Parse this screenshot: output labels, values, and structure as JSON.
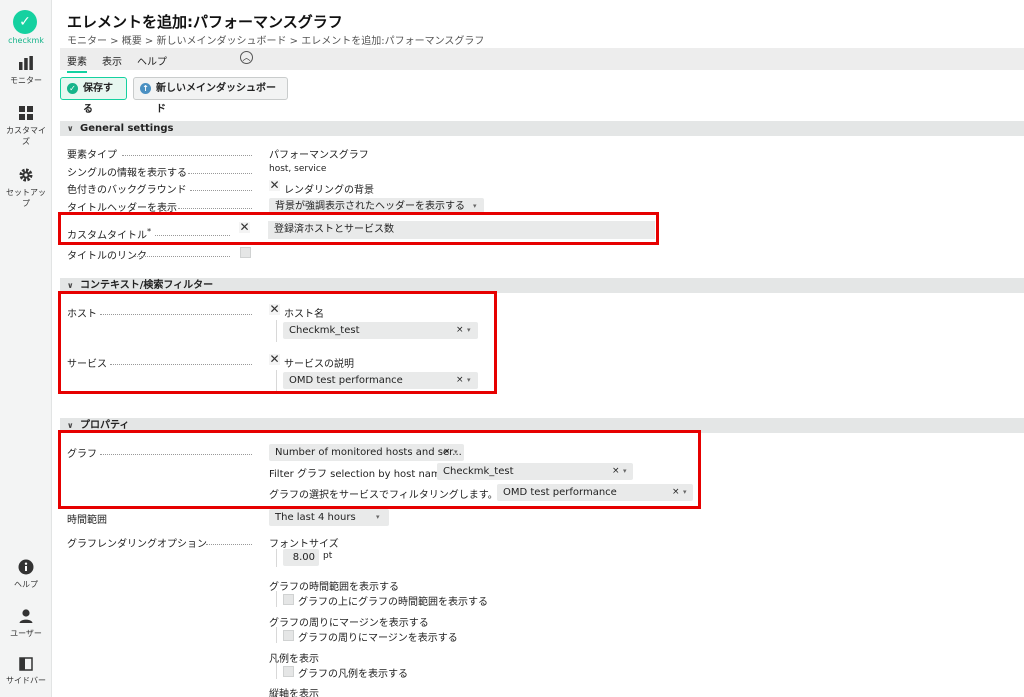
{
  "app": {
    "logo_text": "checkmk",
    "logo_glyph": "✓"
  },
  "sidebar": {
    "items": [
      {
        "label": "モニター",
        "icon": "bar-chart-icon"
      },
      {
        "label": "カスタマイズ",
        "icon": "grid-icon"
      },
      {
        "label": "セットアップ",
        "icon": "gear-icon"
      },
      {
        "label": "ヘルプ",
        "icon": "info-icon"
      },
      {
        "label": "ユーザー",
        "icon": "user-icon"
      },
      {
        "label": "サイドバー",
        "icon": "sidebar-icon"
      }
    ]
  },
  "header": {
    "title": "エレメントを追加:パフォーマンスグラフ",
    "breadcrumb": "モニター > 概要 > 新しいメインダッシュボード > エレメントを追加:パフォーマンスグラフ",
    "menu": [
      "要素",
      "表示",
      "ヘルプ"
    ],
    "collapse_icon": "chevron-up-icon"
  },
  "toolbar": {
    "save_label": "保存する",
    "dashboard_label": "新しいメインダッシュボード"
  },
  "general": {
    "title": "General settings",
    "element_type_label": "要素タイプ",
    "element_type_value": "パフォーマンスグラフ",
    "single_info_label": "シングルの情報を表示する",
    "single_info_value": "host, service",
    "colored_bg_label": "色付きのバックグラウンド",
    "colored_bg_value": "レンダリングの背景",
    "title_header_label": "タイトルヘッダーを表示",
    "title_header_value": "背景が強調表示されたヘッダーを表示する",
    "custom_title_label": "カスタムタイトル",
    "custom_title_mark": "*",
    "custom_title_value": "登録済ホストとサービス数",
    "title_link_label": "タイトルのリンク"
  },
  "context": {
    "title": "コンテキスト/検索フィルター",
    "host_label": "ホスト",
    "host_filter_label": "ホスト名",
    "host_value": "Checkmk_test",
    "service_label": "サービス",
    "service_filter_label": "サービスの説明",
    "service_value": "OMD test performance"
  },
  "properties": {
    "title": "プロパティ",
    "graph_label": "グラフ",
    "graph_value": "Number of monitored hosts and ser...",
    "filter_host_label": "Filter グラフ selection by host name:",
    "filter_host_value": "Checkmk_test",
    "filter_service_label": "グラフの選択をサービスでフィルタリングします。",
    "filter_service_value": "OMD test performance",
    "time_range_label": "時間範囲",
    "time_range_value": "The last 4 hours",
    "render_options_label": "グラフレンダリングオプション",
    "font_size_label": "フォントサイズ",
    "font_size_value": "8.00",
    "font_size_unit": "pt",
    "show_time_range_label": "グラフの時間範囲を表示する",
    "show_time_range_option": "グラフの上にグラフの時間範囲を表示する",
    "show_margin_label": "グラフの周りにマージンを表示する",
    "show_margin_option": "グラフの周りにマージンを表示する",
    "legend_label": "凡例を表示",
    "legend_option": "グラフの凡例を表示する",
    "vertical_axis_label": "縦軸を表示"
  },
  "colors": {
    "accent": "#15d1a0",
    "highlight_box": "#e60000"
  }
}
